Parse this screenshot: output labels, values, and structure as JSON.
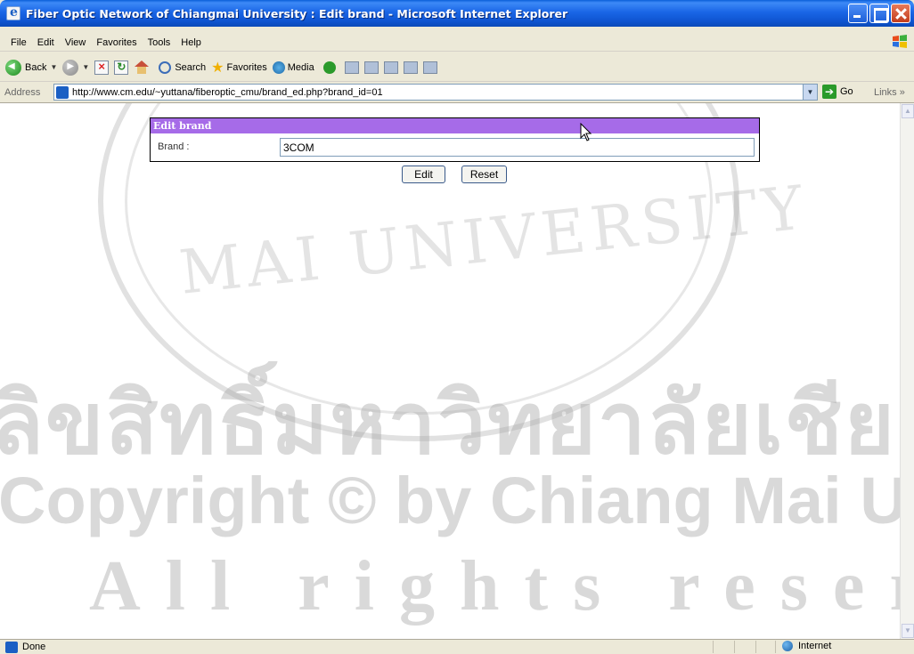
{
  "window": {
    "title": "Fiber Optic Network of Chiangmai University : Edit brand - Microsoft Internet Explorer"
  },
  "menu": [
    "File",
    "Edit",
    "View",
    "Favorites",
    "Tools",
    "Help"
  ],
  "toolbar": {
    "back_label": "Back",
    "search_label": "Search",
    "favorites_label": "Favorites",
    "media_label": "Media"
  },
  "address": {
    "label": "Address",
    "url": "http://www.cm.edu/~yuttana/fiberoptic_cmu/brand_ed.php?brand_id=01",
    "go_label": "Go",
    "links_label": "Links",
    "links_chevron": "»"
  },
  "form": {
    "header": "Edit brand",
    "brand_label": "Brand :",
    "brand_value": "3COM",
    "edit_button": "Edit",
    "reset_button": "Reset"
  },
  "watermark": {
    "arc_text": "MAI UNIVERSITY",
    "thai_text": "ลิขสิทธิ์มหาวิทยาลัยเชียงใหม่",
    "copyright_text": "Copyright © by Chiang Mai University",
    "rights_text": "All rights reserved"
  },
  "status": {
    "text": "Done",
    "zone": "Internet"
  }
}
